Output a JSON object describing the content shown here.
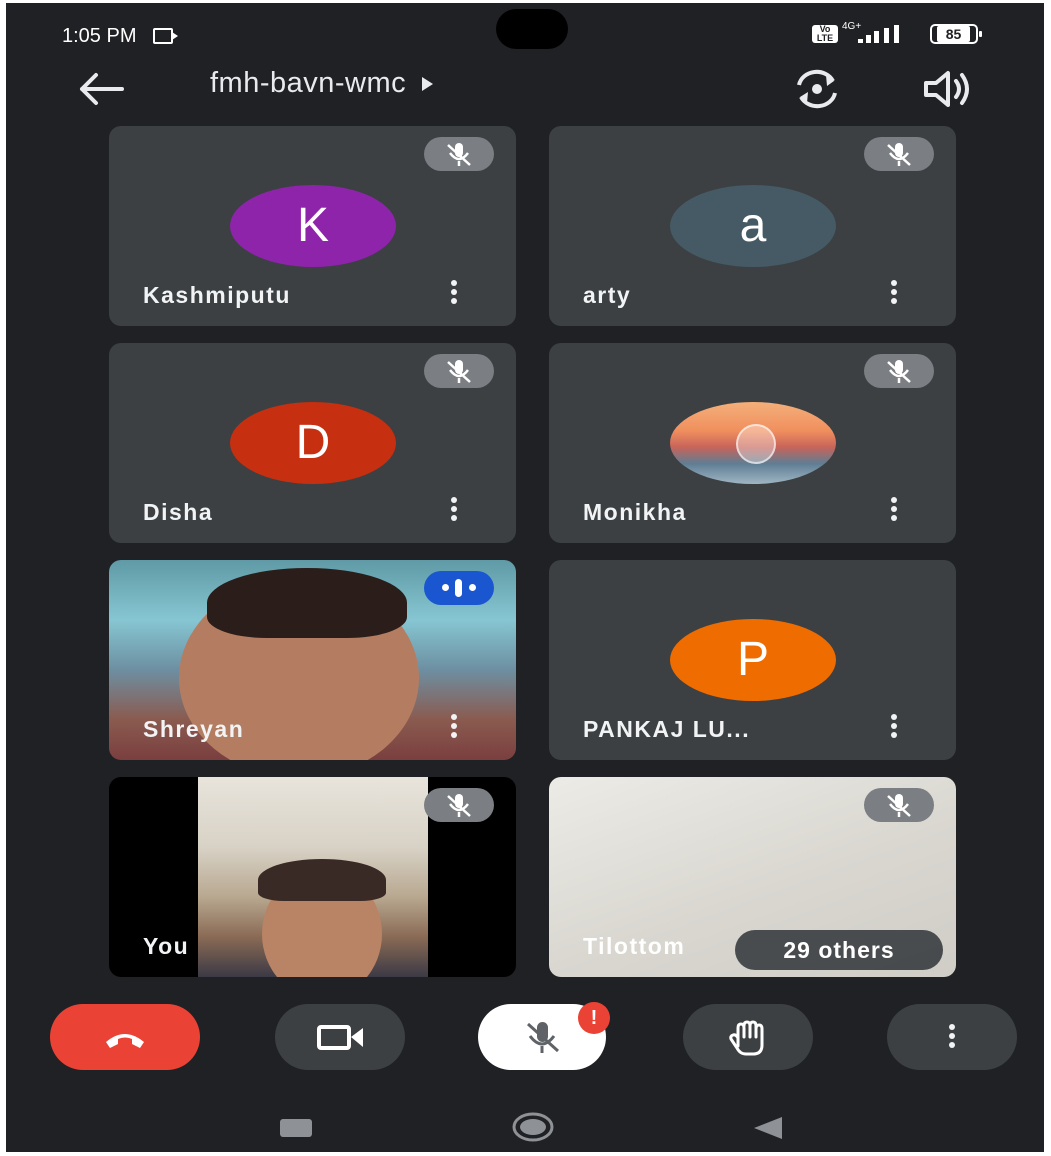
{
  "status_bar": {
    "time": "1:05 PM",
    "volte": "Vo LTE",
    "network": "4G+",
    "battery": "85"
  },
  "header": {
    "meeting_code": "fmh-bavn-wmc"
  },
  "tiles": [
    {
      "name": "Kashmiputu",
      "initial": "K",
      "avatar_color": "#8e24aa",
      "muted": true
    },
    {
      "name": "arty",
      "initial": "a",
      "avatar_color": "#455a64",
      "muted": true
    },
    {
      "name": "Disha",
      "initial": "D",
      "avatar_color": "#c62f0f",
      "muted": true
    },
    {
      "name": "Monikha",
      "initial": "",
      "avatar_color": "#f29a6b",
      "muted": true
    },
    {
      "name": "Shreyan",
      "video": true,
      "speaking": true
    },
    {
      "name": "PANKAJ LU...",
      "initial": "P",
      "avatar_color": "#ef6c00",
      "muted": false
    },
    {
      "name": "You",
      "video": true,
      "muted": true
    },
    {
      "name": "Tilottom",
      "video": true,
      "muted": true
    }
  ],
  "others_label": "29 others",
  "controls": {
    "mic_alert": "!"
  },
  "colors": {
    "background": "#202124",
    "tile": "#3c4043",
    "end_call": "#ea4335",
    "speaking": "#1a56cf"
  }
}
